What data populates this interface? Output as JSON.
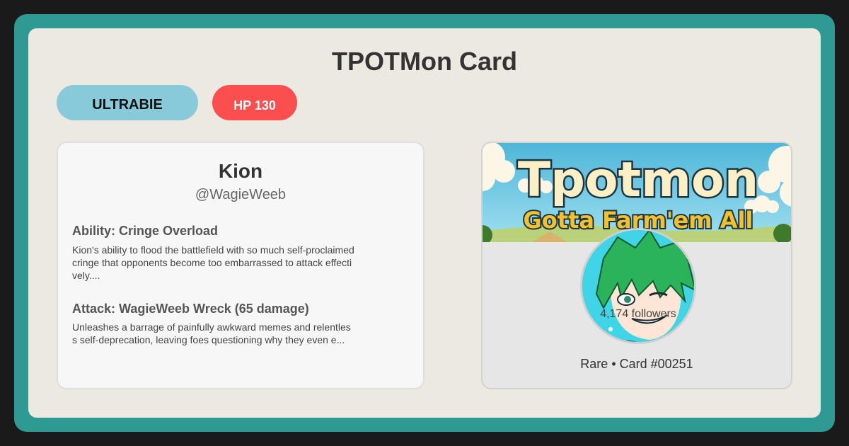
{
  "page": {
    "title": "TPOTMon Card"
  },
  "badges": {
    "type": "ULTRABIE",
    "hp": "HP 130"
  },
  "profile": {
    "name": "Kion",
    "handle": "@WagieWeeb",
    "ability_title": "Ability: Cringe Overload",
    "ability_desc": "Kion's ability to flood the battlefield with so much self-proclaimed cringe that opponents become too embarrassed to attack effectively....",
    "attack_title": "Attack: WagieWeeb Wreck (65 damage)",
    "attack_desc": "Unleashes a barrage of painfully awkward memes and relentless self-deprecation, leaving foes questioning why they even e..."
  },
  "card": {
    "banner_title": "Tpotmon",
    "banner_subtitle": "Gotta Farm'em All",
    "followers": "4,174 followers",
    "rarity": "Rare • Card #00251"
  },
  "colors": {
    "frame": "#2f9a93",
    "background": "#ece9e1",
    "type_badge": "#88cada",
    "hp_badge": "#fb4e4e"
  }
}
